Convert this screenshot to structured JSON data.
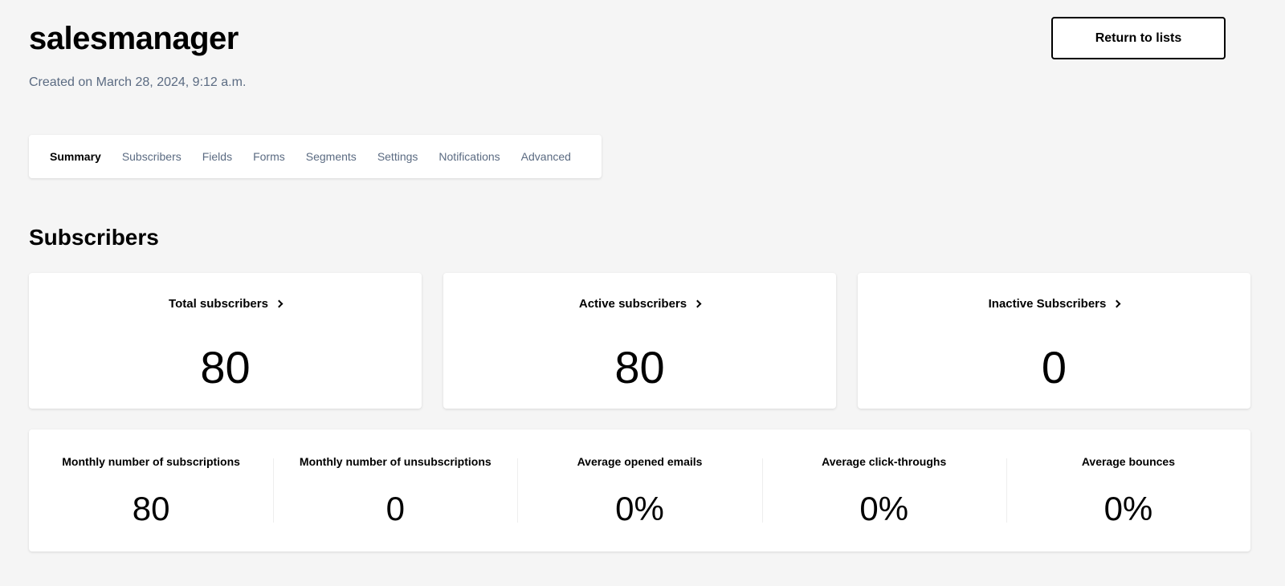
{
  "header": {
    "title": "salesmanager",
    "created_on": "Created on March 28, 2024, 9:12 a.m.",
    "return_label": "Return to lists"
  },
  "tabs": [
    {
      "label": "Summary",
      "active": true
    },
    {
      "label": "Subscribers",
      "active": false
    },
    {
      "label": "Fields",
      "active": false
    },
    {
      "label": "Forms",
      "active": false
    },
    {
      "label": "Segments",
      "active": false
    },
    {
      "label": "Settings",
      "active": false
    },
    {
      "label": "Notifications",
      "active": false
    },
    {
      "label": "Advanced",
      "active": false
    }
  ],
  "section": {
    "title": "Subscribers"
  },
  "cards": [
    {
      "label": "Total subscribers",
      "value": "80",
      "icon": "chevron-right-icon"
    },
    {
      "label": "Active subscribers",
      "value": "80",
      "icon": "chevron-right-icon"
    },
    {
      "label": "Inactive Subscribers",
      "value": "0",
      "icon": "chevron-right-icon"
    }
  ],
  "stats": [
    {
      "label": "Monthly number of subscriptions",
      "value": "80"
    },
    {
      "label": "Monthly number of unsubscriptions",
      "value": "0"
    },
    {
      "label": "Average opened emails",
      "value": "0%"
    },
    {
      "label": "Average click-throughs",
      "value": "0%"
    },
    {
      "label": "Average bounces",
      "value": "0%"
    }
  ],
  "colors": {
    "background": "#f5f5f5",
    "muted_text": "#5b6b82",
    "card": "#ffffff"
  }
}
